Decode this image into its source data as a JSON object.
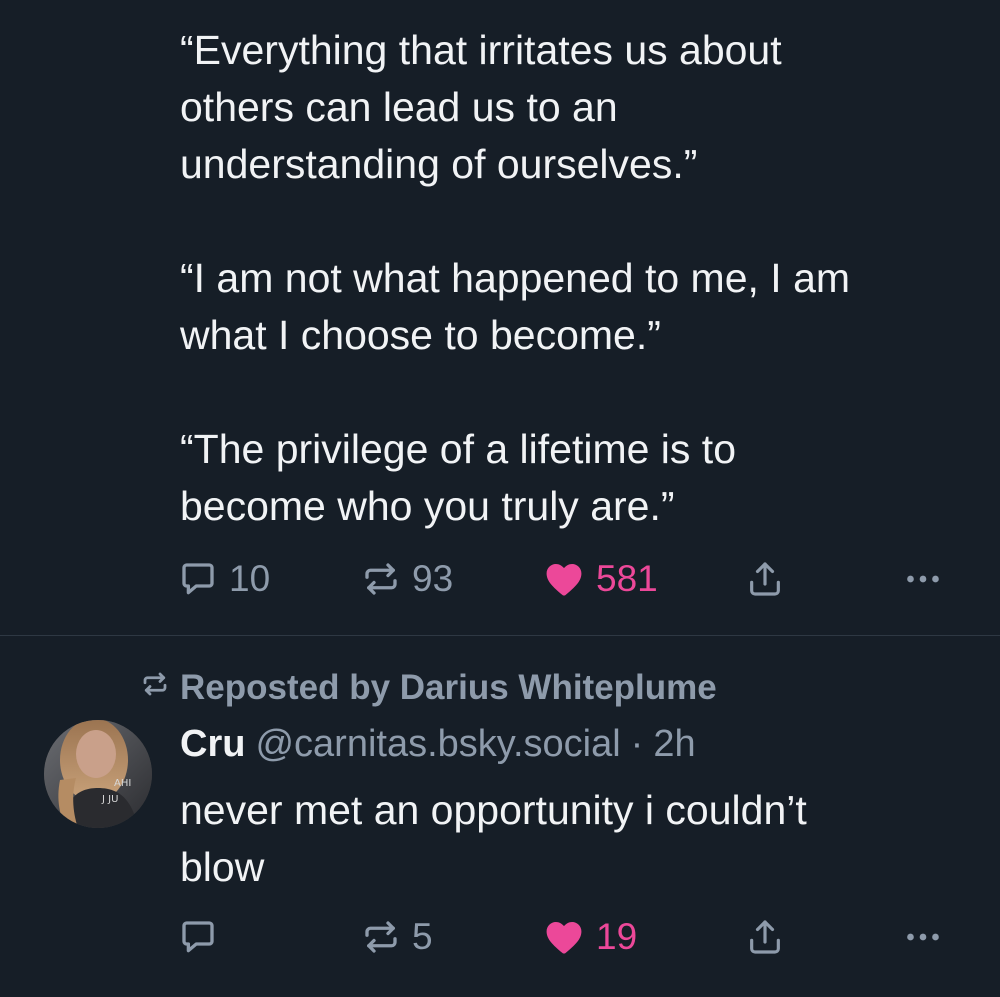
{
  "post1": {
    "text": "“Everything that irritates us about\nothers can lead us to an\nunderstanding of ourselves.”\n\n“I am not what happened to me, I am\nwhat I choose to become.”\n\n“The privilege of a lifetime is to\nbecome who you truly are.”",
    "actions": {
      "reply_count": "10",
      "repost_count": "93",
      "like_count": "581",
      "liked": true
    }
  },
  "post2": {
    "reposted_by": "Reposted by Darius Whiteplume",
    "author": {
      "name": "Cru",
      "handle": "@carnitas.bsky.social",
      "separator": "·",
      "time": "2h"
    },
    "text": "never met an opportunity i couldn’t\nblow",
    "actions": {
      "reply_count": "",
      "repost_count": "5",
      "like_count": "19",
      "liked": true
    }
  },
  "colors": {
    "background": "#161e27",
    "text": "#f1f3f5",
    "muted": "#8e9bab",
    "like": "#ec4899",
    "divider": "#2e3843"
  },
  "icons": [
    "reply-icon",
    "repost-icon",
    "heart-icon",
    "share-icon",
    "more-icon"
  ]
}
